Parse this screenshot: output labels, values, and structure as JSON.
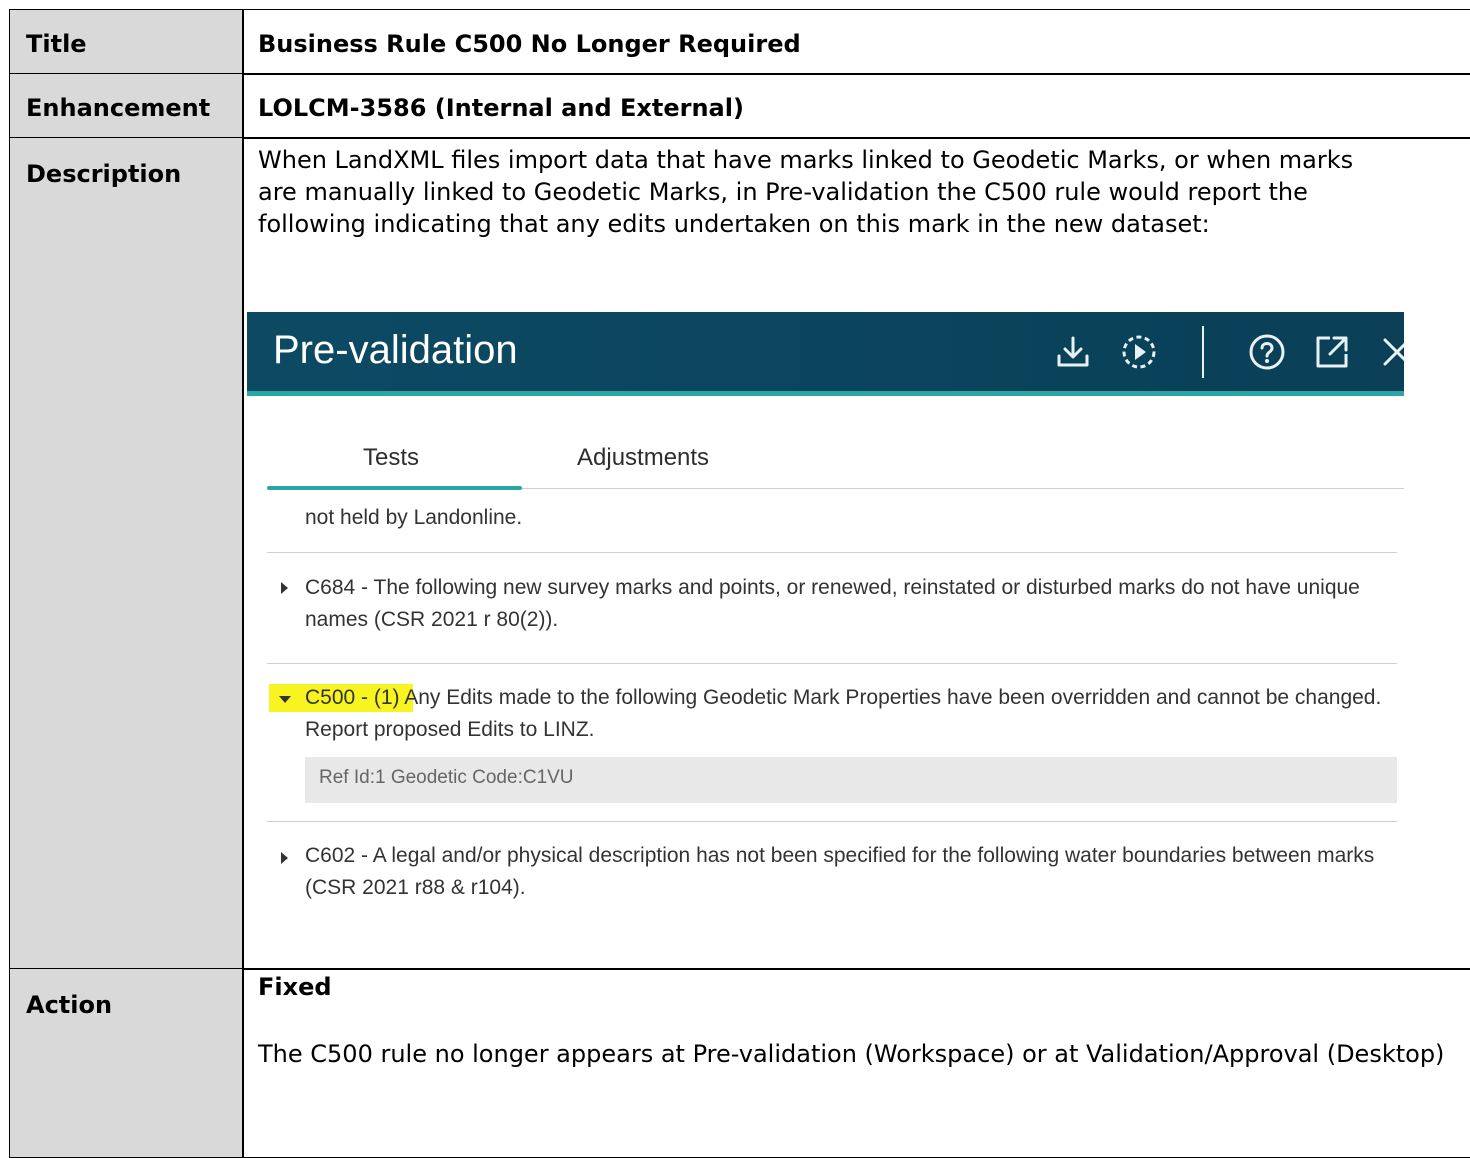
{
  "rows": {
    "title": {
      "label": "Title",
      "value": "Business Rule C500 No Longer Required"
    },
    "enhancement": {
      "label": "Enhancement",
      "value": "LOLCM-3586 (Internal and External)"
    },
    "description": {
      "label": "Description",
      "text": "When LandXML files import data that have marks linked to Geodetic Marks, or when marks are manually linked to Geodetic Marks, in Pre-validation the C500 rule would report the following indicating that any edits undertaken on this mark in the new dataset:"
    },
    "action": {
      "label": "Action",
      "status": "Fixed",
      "text": "The C500 rule no longer appears at Pre-validation (Workspace) or at Validation/Approval (Desktop)"
    }
  },
  "screenshot": {
    "header_title": "Pre-validation",
    "header_icons": [
      "download-icon",
      "run-icon",
      "help-icon",
      "open-external-icon",
      "close-icon"
    ],
    "tabs": [
      "Tests",
      "Adjustments"
    ],
    "active_tab": "Tests",
    "items": {
      "truncated": "not held by Landonline.",
      "c684": "C684 - The following new survey marks and points, or renewed, reinstated or disturbed marks do not have unique names (CSR 2021 r 80(2)).",
      "c500_code": "C500 - (1) ",
      "c500_text": "Any Edits made to the following Geodetic Mark Properties have been overridden and cannot be changed. Report proposed Edits to LINZ.",
      "c500_detail": "Ref Id:1 Geodetic Code:C1VU",
      "c602": "C602 - A legal and/or physical description has not been specified for the following water boundaries between marks (CSR 2021 r88 & r104)."
    },
    "colors": {
      "header": "#0c4a63",
      "accent": "#2aa6a6",
      "highlight": "#f8f422"
    }
  }
}
